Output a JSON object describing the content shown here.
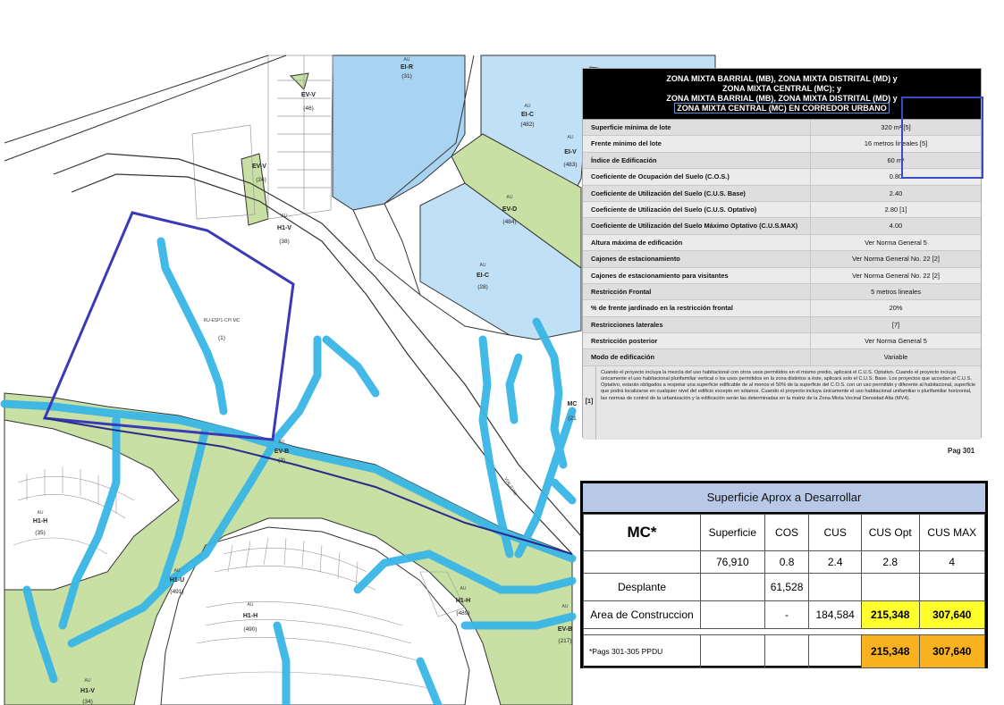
{
  "map": {
    "labels": [
      {
        "zone": "EI-R",
        "num": "(31)"
      },
      {
        "zone": "EI-C",
        "num": "(482)"
      },
      {
        "zone": "EI-V",
        "num": "(483)"
      },
      {
        "zone": "EV-D",
        "num": "(484)"
      },
      {
        "zone": "EI-C",
        "num": "(28)"
      },
      {
        "zone": "H1-V",
        "num": "(38)"
      },
      {
        "zone": "EV-V",
        "num": "(24)"
      },
      {
        "zone": "EV-V",
        "num": "(46)"
      },
      {
        "zone": "RU-ESP1-CP/ MC",
        "num": "(1)"
      },
      {
        "zone": "EV-B",
        "num": "(3)"
      },
      {
        "zone": "H1-H",
        "num": "(35)"
      },
      {
        "zone": "H1-U",
        "num": "(491)"
      },
      {
        "zone": "H1-H",
        "num": "(490)"
      },
      {
        "zone": "H1-H",
        "num": "(489)"
      },
      {
        "zone": "EV-B",
        "num": "(217)"
      },
      {
        "zone": "H1-V",
        "num": "(34)"
      },
      {
        "zone": "MC",
        "num": "(21"
      },
      {
        "zone": "AU",
        "num": ""
      }
    ]
  },
  "regulation": {
    "header": [
      "ZONA MIXTA BARRIAL (MB), ZONA MIXTA DISTRITAL (MD) y",
      "ZONA MIXTA CENTRAL (MC); y",
      "ZONA MIXTA BARRIAL (MB), ZONA MIXTA DISTRITAL (MD) y",
      "ZONA MIXTA CENTRAL (MC) EN CORREDOR URBANO"
    ],
    "rows": [
      {
        "label": "Superficie mínima de lote",
        "value": "320 m² [5]"
      },
      {
        "label": "Frente mínimo del lote",
        "value": "16 metros lineales [5]"
      },
      {
        "label": "Índice de Edificación",
        "value": "60 m²"
      },
      {
        "label": "Coeficiente de Ocupación del Suelo (C.O.S.)",
        "value": "0.80"
      },
      {
        "label": "Coeficiente de Utilización del Suelo (C.U.S. Base)",
        "value": "2.40"
      },
      {
        "label": "Coeficiente de Utilización del Suelo (C.U.S. Optativo)",
        "value": "2.80 [1]"
      },
      {
        "label": "Coeficiente de Utilización del Suelo Máximo Optativo (C.U.S.MAX)",
        "value": "4.00"
      },
      {
        "label": "Altura máxima de edificación",
        "value": "Ver Norma General 5"
      },
      {
        "label": "Cajones de estacionamiento",
        "value": "Ver Norma General No. 22 [2]"
      },
      {
        "label": "Cajones de estacionamiento para visitantes",
        "value": "Ver Norma General No. 22 [2]"
      },
      {
        "label": "Restricción Frontal",
        "value": "5 metros lineales"
      },
      {
        "label": "% de frente jardinado en la restricción frontal",
        "value": "20%"
      },
      {
        "label": "Restricciones laterales",
        "value": "[7]"
      },
      {
        "label": "Restricción posterior",
        "value": "Ver Norma General 5"
      },
      {
        "label": "Modo de edificación",
        "value": "Variable"
      }
    ],
    "note_label": "[1]",
    "note_text": "Cuando el proyecto incluya la mezcla del uso habitacional con otros usos permitidos en el mismo predio, aplicará el C.U.S. Optativo. Cuando el proyecto incluya únicamente el uso habitacional plurifamiliar vertical o los usos permitidos en la zona distintos a éste, aplicará solo el C.U.S. Base. Los proyectos que accedan al C.U.S. Optativo, estarán obligados a respetar una superficie edificable de al menos el 50% de la superficie del C.O.S. con un uso permitido y diferente al habitacional, superficie que podrá localizarse en cualquier nivel del edificio excepto en sótanos. Cuando el proyecto incluya únicamente el uso habitacional unifamiliar o plurifamiliar horizontal, las normas de control de la urbanización y la edificación serán las determinadas en la matriz de la Zona Mixta Vecinal Densidad Alta (MV4).",
    "page": "Pag 301"
  },
  "summary": {
    "title": "Superficie Aprox a Desarrollar",
    "headers": [
      "MC*",
      "Superficie",
      "COS",
      "CUS",
      "CUS Opt",
      "CUS MAX"
    ],
    "values": [
      "",
      "76,910",
      "0.8",
      "2.4",
      "2.8",
      "4"
    ],
    "desplante": {
      "label": "Desplante",
      "cos": "61,528"
    },
    "area": {
      "label": "Area de Construccion",
      "cos": "-",
      "cus": "184,584",
      "cus_opt": "215,348",
      "cus_max": "307,640"
    },
    "footer": {
      "note": "*Pags 301-305 PPDU",
      "cus_opt": "215,348",
      "cus_max": "307,640"
    },
    "colors": {
      "yellow": "#ffff2e",
      "orange": "#f8b21f",
      "title_bg": "#b8c9e8"
    }
  }
}
